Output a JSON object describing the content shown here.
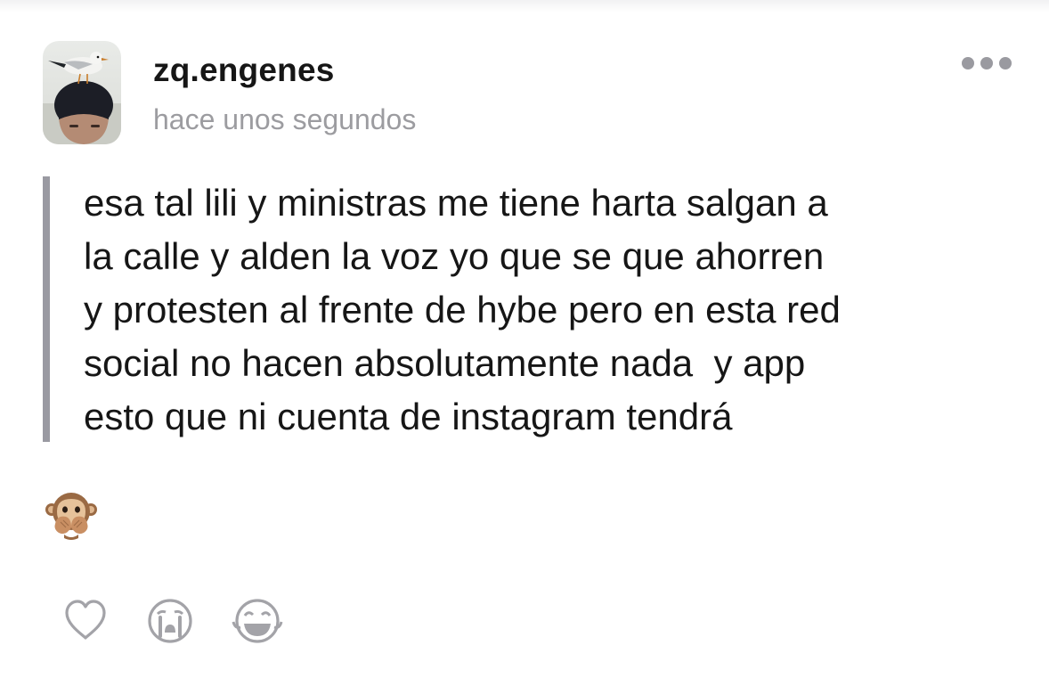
{
  "post": {
    "username": "zq.engenes",
    "timestamp": "hace unos segundos",
    "lines": [
      "esa tal lili y ministras me tiene harta salgan a",
      "la calle y alden la voz yo que se que ahorren",
      "y protesten al frente de hybe pero en esta red",
      "social no hacen absolutamente nada  y app",
      "esto que ni cuenta de instagram tendrá"
    ],
    "attached_emoji": "see-no-evil-monkey"
  },
  "icons": {
    "more": "more-dots-icon",
    "like": "heart-icon",
    "cry": "crying-face-icon",
    "laugh": "laughing-face-icon"
  },
  "colors": {
    "text": "#161616",
    "muted": "#9c9ca0",
    "icon": "#a3a3a8",
    "quote_bar": "#9a9aa2"
  }
}
